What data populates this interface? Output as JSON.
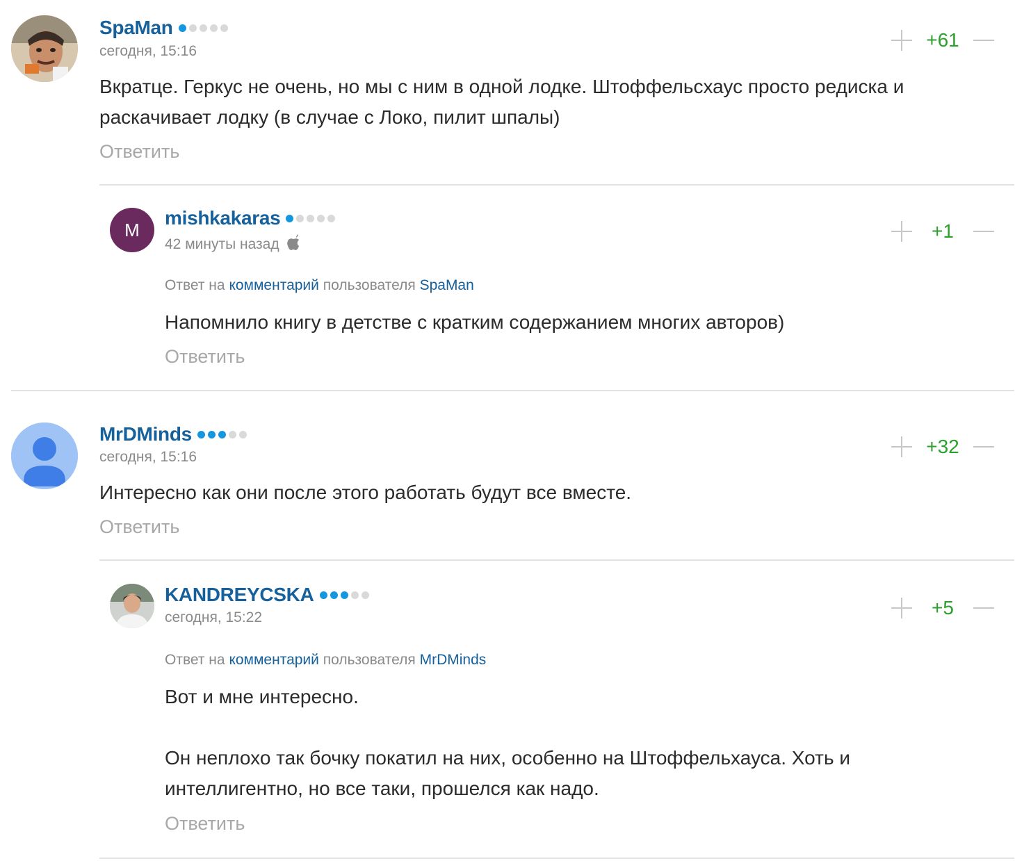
{
  "reply_label": "Ответить",
  "reply_to": {
    "prefix": "Ответ на",
    "comment_link": "комментарий",
    "middle": "пользователя"
  },
  "colors": {
    "username": "#16609b",
    "rating_on": "#1597e0",
    "rating_off": "#d9d9d9",
    "score": "#2ca02c"
  },
  "comments": [
    {
      "username": "SpaMan",
      "rating_dots": 1,
      "time": "сегодня, 15:16",
      "score": "+61",
      "text": "Вкратце. Геркус не очень, но мы с ним в одной лодке. Штоффельсхаус просто редиска и раскачивает лодку (в случае с Локо, пилит шпалы)"
    },
    {
      "username": "mishkakaras",
      "avatar_letter": "M",
      "avatar_color": "#6a2a5e",
      "rating_dots": 1,
      "time": "42 минуты назад",
      "device_icon": "apple-icon",
      "score": "+1",
      "reply_to_user": "SpaMan",
      "text": "Напомнило книгу в детстве с кратким содержанием многих авторов)"
    },
    {
      "username": "MrDMinds",
      "avatar_color": "#9fc3f5",
      "rating_dots": 3,
      "time": "сегодня, 15:16",
      "score": "+32",
      "text": "Интересно как они после этого работать будут все вместе."
    },
    {
      "username": "KANDREYCSKA",
      "rating_dots": 3,
      "time": "сегодня, 15:22",
      "score": "+5",
      "reply_to_user": "MrDMinds",
      "text_paragraphs": [
        "Вот и мне интересно.",
        "Он неплохо так бочку покатил на них, особенно на Штоффельхауса. Хоть и интеллигентно, но все таки, прошелся как надо."
      ]
    }
  ]
}
